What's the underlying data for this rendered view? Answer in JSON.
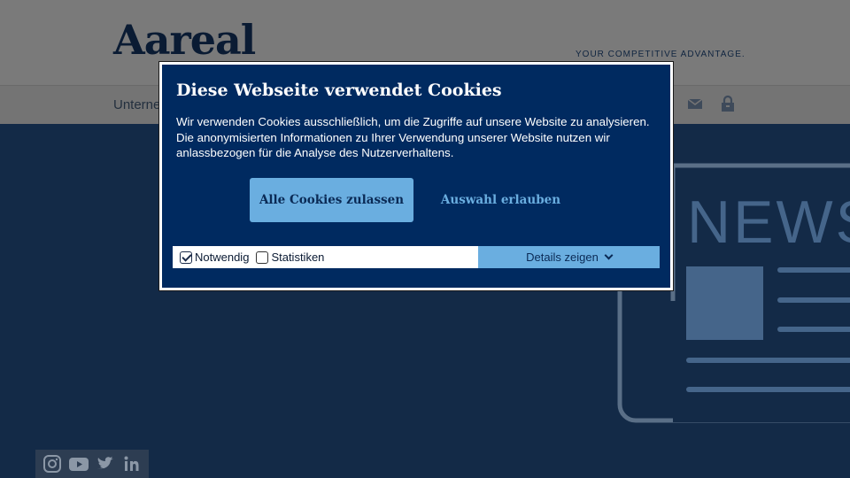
{
  "header": {
    "logo_text": "Aareal",
    "tagline": "YOUR COMPETITIVE ADVANTAGE."
  },
  "nav": {
    "partial_item": "Unterne",
    "icons": [
      "mail-icon",
      "lock-icon"
    ]
  },
  "hero": {
    "illustration_text": "NEWS"
  },
  "social": {
    "icons": [
      "instagram-icon",
      "youtube-icon",
      "twitter-icon",
      "linkedin-icon"
    ]
  },
  "cookie_modal": {
    "title": "Diese Webseite verwendet Cookies",
    "body": "Wir verwenden Cookies ausschließlich, um die Zugriffe auf unsere Website zu analysieren. Die anonymisierten Informationen zu Ihrer Verwendung unserer Website nutzen wir anlassbezogen für die Analyse des Nutzerverhaltens.",
    "accept_all_label": "Alle Cookies zulassen",
    "allow_selection_label": "Auswahl erlauben",
    "options": [
      {
        "label": "Notwendig",
        "checked": true
      },
      {
        "label": "Statistiken",
        "checked": false
      }
    ],
    "details_label": "Details zeigen"
  },
  "colors": {
    "modal_bg": "#002a60",
    "accent": "#6aaee0",
    "hero_bg": "#132a47"
  }
}
